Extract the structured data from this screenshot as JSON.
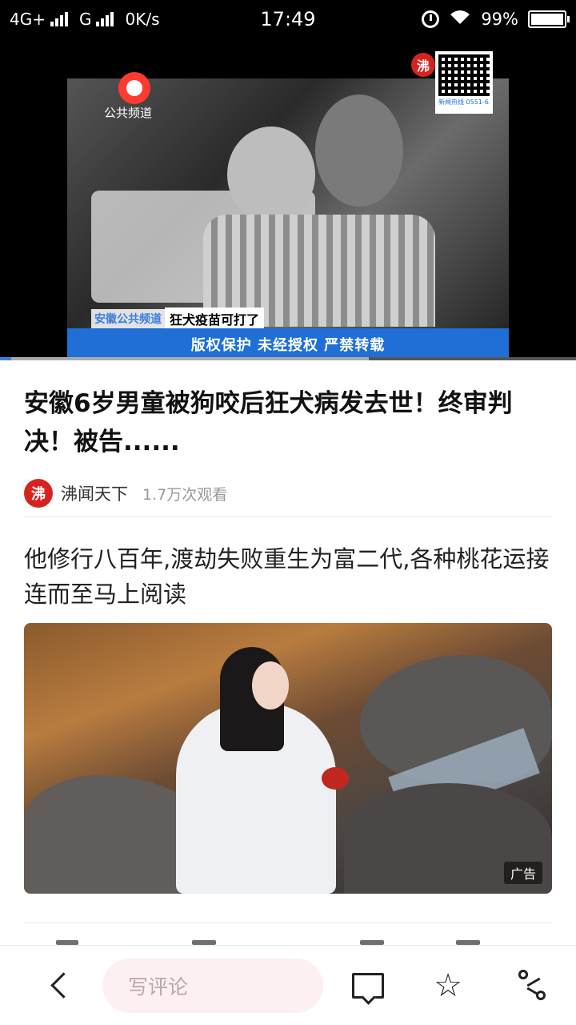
{
  "status_bar": {
    "network": "4G+",
    "network2": "G",
    "speed": "0K/s",
    "time": "17:49",
    "battery": "99%",
    "battery_level": 0.99
  },
  "video": {
    "channel_name": "公共频道",
    "caption_channel": "安徽公共频道",
    "caption_text": "狂犬疫苗可打了",
    "copyright_text": "版权保护  未经授权  严禁转载",
    "corner_logo_char": "沸",
    "qr_label": "新闻热线 0551-63459191",
    "progress": 0.02,
    "buffered": 0.64
  },
  "article": {
    "title": "安徽6岁男童被狗咬后狂犬病发去世！终审判决！被告......",
    "source_avatar_char": "沸",
    "source_name": "沸闻天下",
    "views": "1.7万次观看"
  },
  "ad": {
    "title": "他修行八百年,渡劫失败重生为富二代,各种桃花运接连而至马上阅读",
    "badge": "广告"
  },
  "toolbar": {
    "comment_placeholder": "写评论",
    "back_icon": "back-arrow-icon",
    "comment_icon": "comment-icon",
    "favorite_icon": "star-icon",
    "share_icon": "share-icon"
  }
}
